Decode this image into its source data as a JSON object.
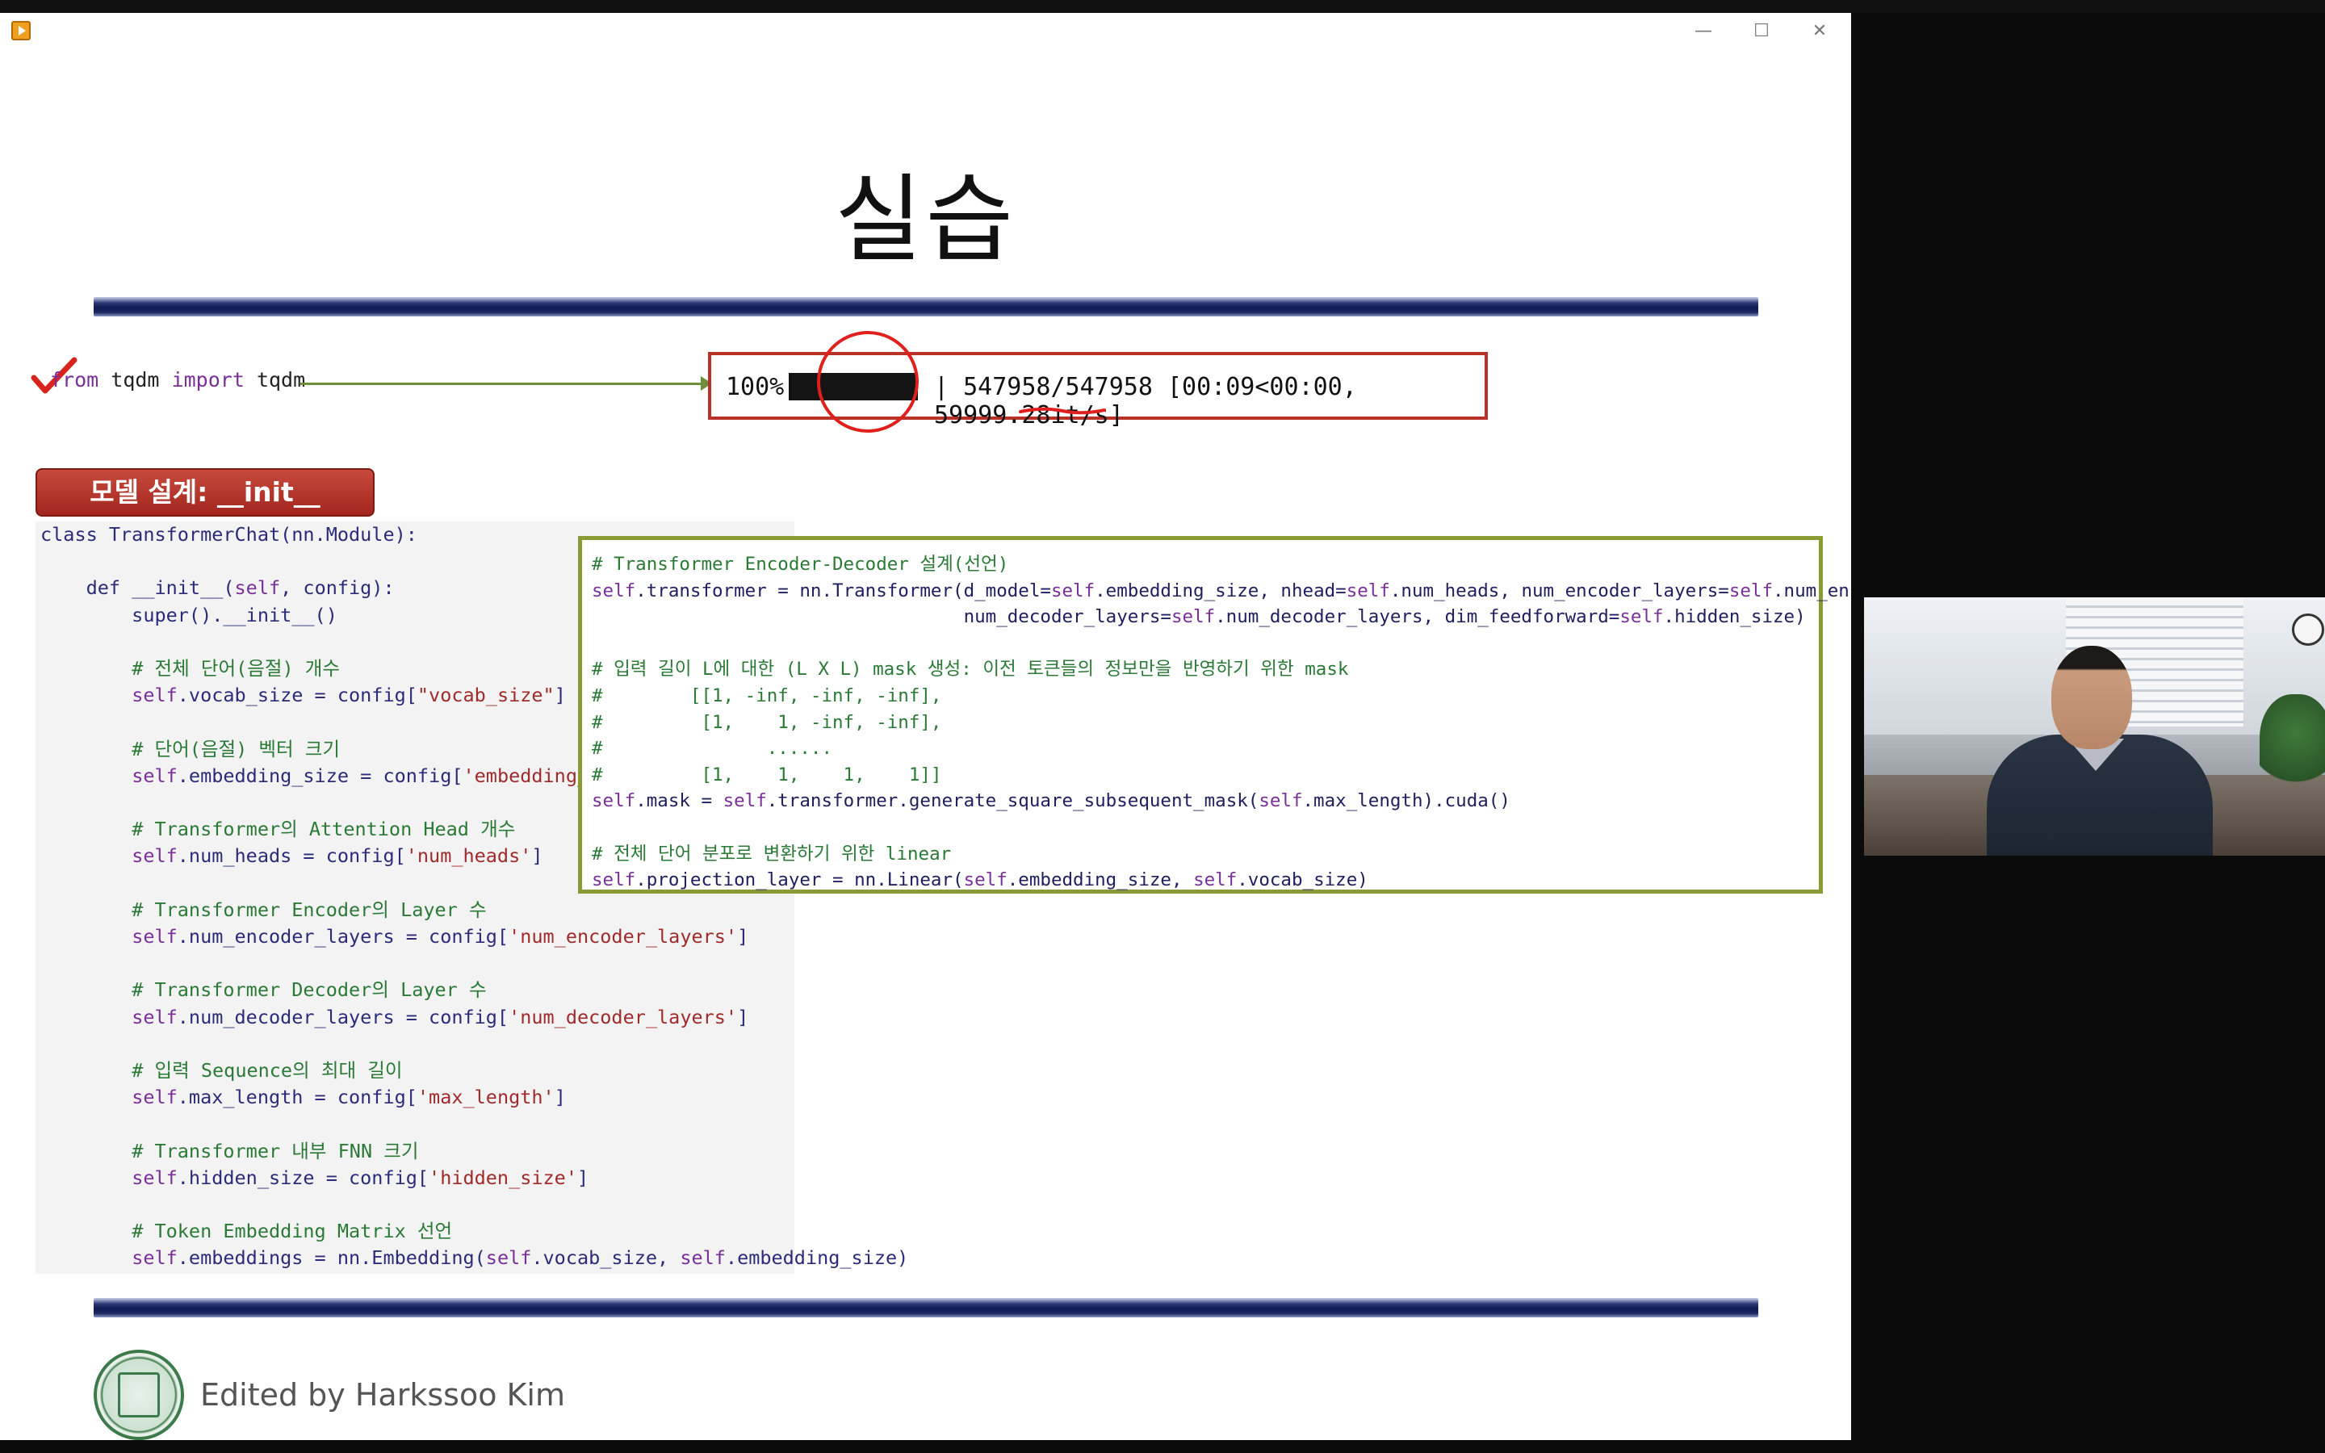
{
  "slide": {
    "title": "실습",
    "import_line": {
      "keyword_from": "from",
      "module": "tqdm",
      "keyword_import": "import",
      "name": "tqdm"
    },
    "progress": {
      "percent_label": "100%",
      "fraction": 1.0,
      "rest_label": "| 547958/547958 [00:09<00:00, 59999.28it/s]"
    },
    "section_title": "모델 설계: __init__",
    "code_left": [
      "class TransformerChat(nn.Module):",
      "",
      "    def __init__(self, config):",
      "        super().__init__()",
      "",
      "        # 전체 단어(음절) 개수",
      "        self.vocab_size = config[\"vocab_size\"]",
      "",
      "        # 단어(음절) 벡터 크기",
      "        self.embedding_size = config['embedding_size']",
      "",
      "        # Transformer의 Attention Head 개수",
      "        self.num_heads = config['num_heads']",
      "",
      "        # Transformer Encoder의 Layer 수",
      "        self.num_encoder_layers = config['num_encoder_layers']",
      "",
      "        # Transformer Decoder의 Layer 수",
      "        self.num_decoder_layers = config['num_decoder_layers']",
      "",
      "        # 입력 Sequence의 최대 길이",
      "        self.max_length = config['max_length']",
      "",
      "        # Transformer 내부 FNN 크기",
      "        self.hidden_size = config['hidden_size']",
      "",
      "        # Token Embedding Matrix 선언",
      "        self.embeddings = nn.Embedding(self.vocab_size, self.embedding_size)"
    ],
    "code_overlay": [
      "# Transformer Encoder-Decoder 설계(선언)",
      "self.transformer = nn.Transformer(d_model=self.embedding_size, nhead=self.num_heads, num_encoder_layers=self.num_encoder_layers,",
      "                                  num_decoder_layers=self.num_decoder_layers, dim_feedforward=self.hidden_size)",
      "",
      "# 입력 길이 L에 대한 (L X L) mask 생성: 이전 토큰들의 정보만을 반영하기 위한 mask",
      "#        [[1, -inf, -inf, -inf],",
      "#         [1,    1, -inf, -inf],",
      "#               ......",
      "#         [1,    1,    1,    1]]",
      "self.mask = self.transformer.generate_square_subsequent_mask(self.max_length).cuda()",
      "",
      "# 전체 단어 분포로 변환하기 위한 linear",
      "self.projection_layer = nn.Linear(self.embedding_size, self.vocab_size)"
    ],
    "footer_text": "Edited by Harkssoo Kim"
  },
  "window_controls": {
    "minimize": "—",
    "maximize": "☐",
    "close": "✕"
  },
  "icons": {
    "app": "video-player-icon",
    "seal": "university-seal-icon"
  },
  "colors": {
    "accent_red": "#b8322a",
    "bar_navy": "#0e1a52",
    "overlay_border": "#8a9a34",
    "comment_green": "#2a7a36"
  }
}
